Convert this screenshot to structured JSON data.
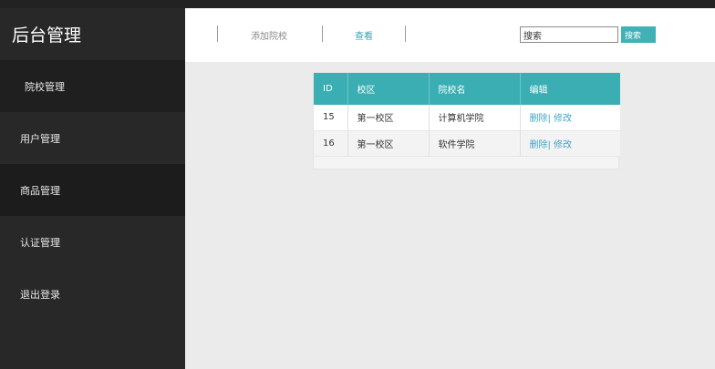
{
  "app": {
    "title": "后台管理"
  },
  "sidebar": {
    "items": [
      {
        "label": "院校管理"
      },
      {
        "label": "用户管理"
      },
      {
        "label": "商品管理"
      },
      {
        "label": "认证管理"
      },
      {
        "label": "退出登录"
      }
    ]
  },
  "header": {
    "add_label": "添加院校",
    "view_label": "查看",
    "search": {
      "value": "搜索",
      "button": "搜索"
    }
  },
  "table": {
    "headers": [
      "ID",
      "校区",
      "院校名",
      "编辑"
    ],
    "rows": [
      {
        "id": "15",
        "campus": "第一校区",
        "name": "计算机学院",
        "delete": "删除",
        "sep": "|",
        "edit": " 修改"
      },
      {
        "id": "16",
        "campus": "第一校区",
        "name": "软件学院",
        "delete": "删除",
        "sep": "|",
        "edit": " 修改"
      }
    ]
  },
  "colors": {
    "accent": "#3aaeb3",
    "sidebar": "#282828",
    "link": "#3fa6c8"
  }
}
